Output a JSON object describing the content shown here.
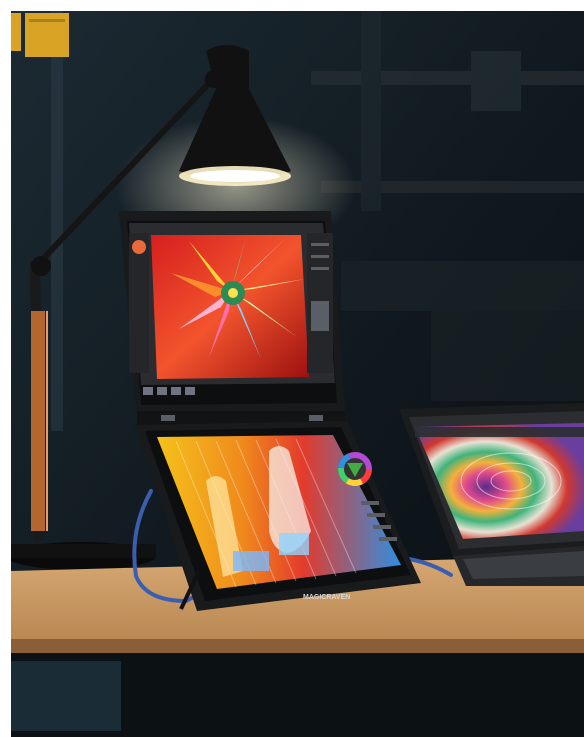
{
  "scene": {
    "brand_on_bezel": "MAGICRAVEN",
    "objects": [
      "desk-lamp",
      "dual-screen-portable-monitor",
      "laptop",
      "wooden-desk",
      "usb-cables"
    ],
    "colors": {
      "background": "#0f1418",
      "desk": "#c99a67",
      "desk_edge": "#8a5e37",
      "lamp_body": "#121212",
      "lamp_glow": "#fff3c8",
      "monitor_bezel": "#181a1c",
      "cable": "#3a5fb0"
    }
  }
}
